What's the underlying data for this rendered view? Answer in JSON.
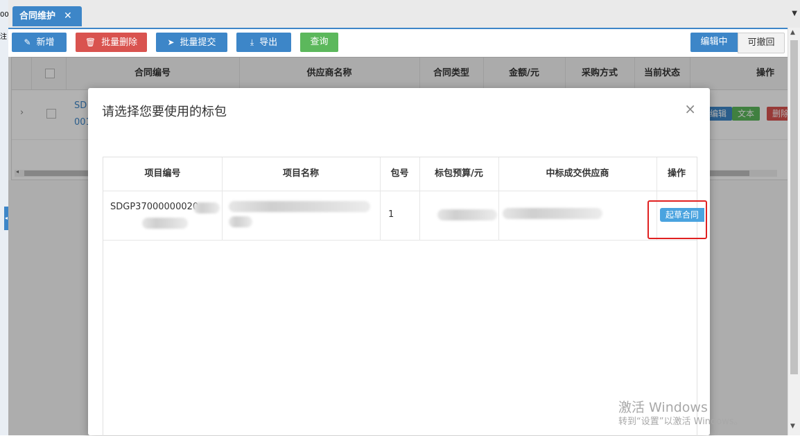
{
  "tabs": [
    {
      "label": "合同维护",
      "close": "✕"
    }
  ],
  "toolbar": {
    "add": "新增",
    "batch_delete": "批量删除",
    "batch_submit": "批量提交",
    "export": "导出",
    "query": "查询",
    "mode_editing": "编辑中",
    "mode_revocable": "可撤回"
  },
  "grid": {
    "columns": [
      "合同编号",
      "供应商名称",
      "合同类型",
      "金额/元",
      "采购方式",
      "当前状态",
      "操作"
    ],
    "row": {
      "contract_no_line1": "SD",
      "contract_no_line2": "001",
      "actions": [
        "编辑",
        "文本",
        "删除"
      ]
    }
  },
  "modal": {
    "title": "请选择您要使用的标包",
    "close": "×",
    "columns": [
      "项目编号",
      "项目名称",
      "包号",
      "标包预算/元",
      "中标成交供应商",
      "操作"
    ],
    "rows": [
      {
        "project_no": "SDGP37000000020",
        "package_no": "1",
        "action": "起草合同"
      }
    ]
  },
  "watermark": {
    "line1": "激活 Windows",
    "line2": "转到“设置”以激活 Windows。"
  },
  "colors": {
    "primary": "#3d86c8",
    "danger": "#d9534f",
    "success": "#5cb85c",
    "highlight": "#e02020"
  }
}
